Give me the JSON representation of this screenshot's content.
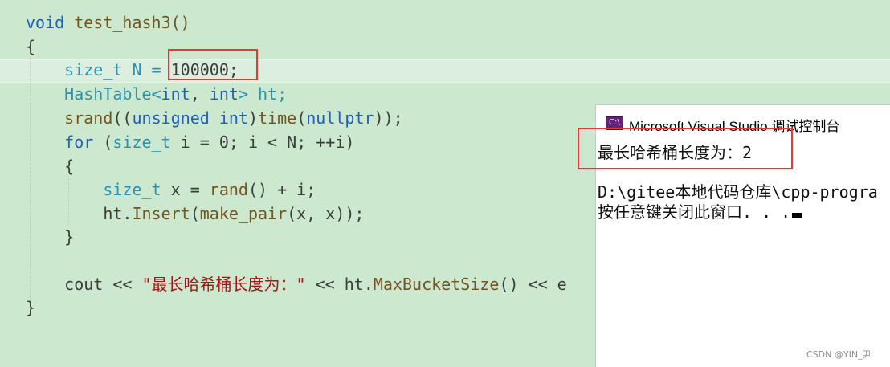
{
  "code": {
    "l1": {
      "kw": "void",
      "name": " test_hash3()"
    },
    "l2": "{",
    "l3": {
      "ty": "size_t",
      "a": " N = ",
      "num": "100000",
      "end": ";"
    },
    "l4": {
      "ty": "HashTable",
      "a": "<",
      "kw1": "int",
      "b": ", ",
      "kw2": "int",
      "c": "> ht;"
    },
    "l5": {
      "fn": "srand",
      "a": "((",
      "kw1": "unsigned",
      "sp": " ",
      "kw2": "int",
      "b": ")",
      "fn2": "time",
      "c": "(",
      "kw3": "nullptr",
      "d": "));"
    },
    "l6": {
      "kw": "for",
      "a": " (",
      "ty": "size_t",
      "b": " i = 0; i < N; ++i)"
    },
    "l7": "{",
    "l8": {
      "ty": "size_t",
      "a": " x = ",
      "fn": "rand",
      "b": "() + i;"
    },
    "l9": {
      "a": "ht.",
      "fn": "Insert",
      "b": "(",
      "fn2": "make_pair",
      "c": "(x, x));"
    },
    "l10": "}",
    "l12": {
      "a": "cout << ",
      "str": "\"最长哈希桶长度为：\"",
      "b": " << ht.",
      "fn": "MaxBucketSize",
      "c": "() << e"
    },
    "l13": "}"
  },
  "console": {
    "title": "Microsoft Visual Studio 调试控制台",
    "icon": "C:\\",
    "output_line1": "最长哈希桶长度为：2",
    "output_line2": "D:\\gitee本地代码仓库\\cpp-progra",
    "output_line3": "按任意键关闭此窗口. . ."
  },
  "watermark": "CSDN @YIN_尹"
}
